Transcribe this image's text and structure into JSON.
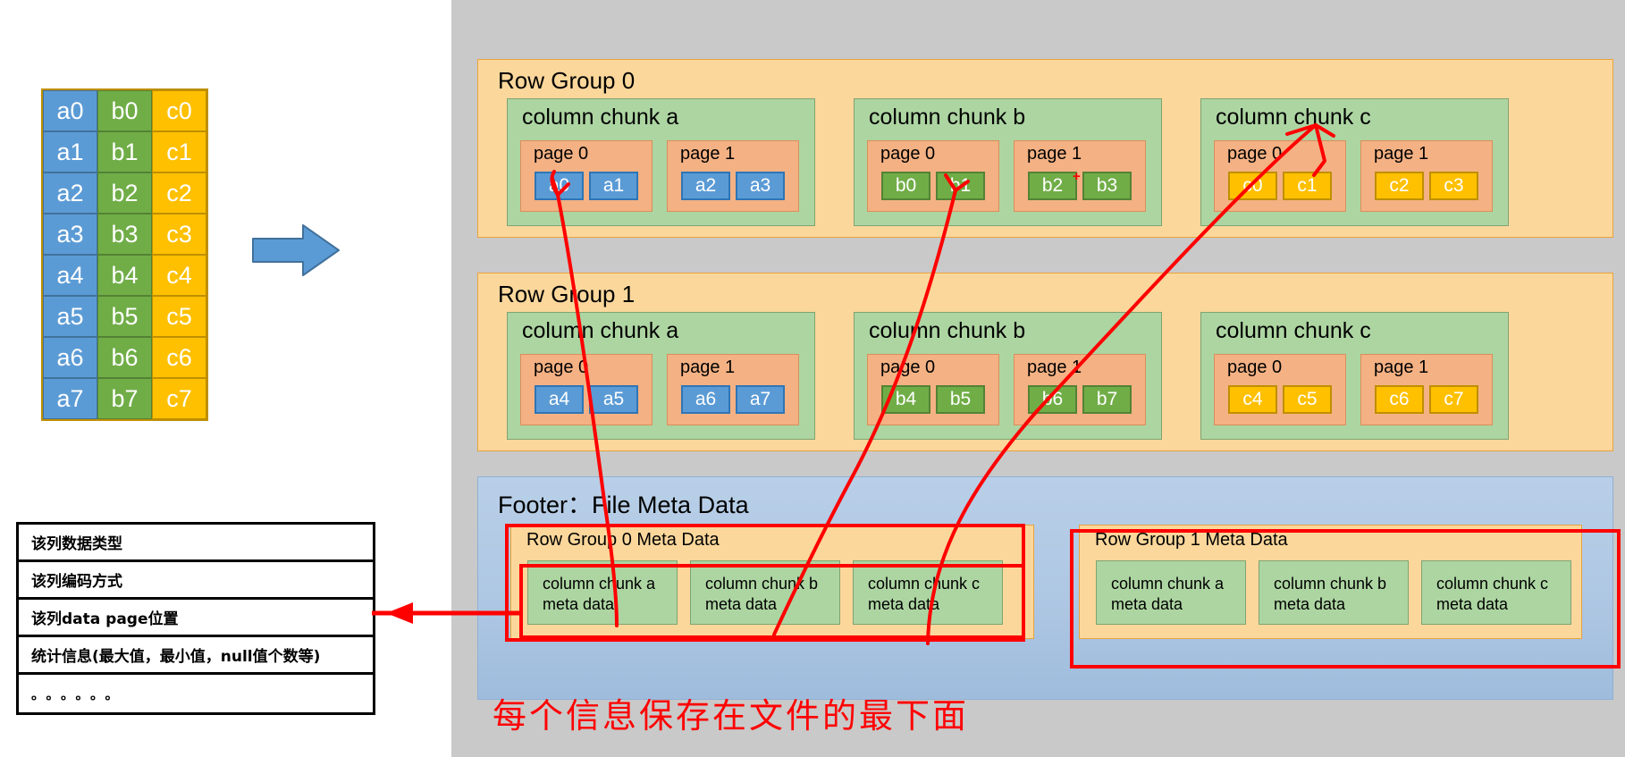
{
  "source_table": {
    "columns": [
      {
        "name": "a",
        "color": "#5b9bd5",
        "cells": [
          "a0",
          "a1",
          "a2",
          "a3",
          "a4",
          "a5",
          "a6",
          "a7"
        ]
      },
      {
        "name": "b",
        "color": "#70ad47",
        "cells": [
          "b0",
          "b1",
          "b2",
          "b3",
          "b4",
          "b5",
          "b6",
          "b7"
        ]
      },
      {
        "name": "c",
        "color": "#ffc000",
        "cells": [
          "c0",
          "c1",
          "c2",
          "c3",
          "c4",
          "c5",
          "c6",
          "c7"
        ]
      }
    ]
  },
  "flow_arrow": {
    "icon": "right-arrow-icon",
    "color": "#5b9bd5"
  },
  "column_meta_table": {
    "rows": [
      "该列数据类型",
      "该列编码方式",
      "该列data page位置",
      "统计信息(最大值，最小值，null值个数等)",
      "。。。。。。"
    ]
  },
  "row_groups": [
    {
      "title": "Row Group 0",
      "chunks": [
        {
          "title": "column chunk a",
          "pages": [
            {
              "title": "page 0",
              "values": [
                "a0",
                "a1"
              ],
              "kind": "a"
            },
            {
              "title": "page 1",
              "values": [
                "a2",
                "a3"
              ],
              "kind": "a"
            }
          ]
        },
        {
          "title": "column chunk b",
          "pages": [
            {
              "title": "page 0",
              "values": [
                "b0",
                "b1"
              ],
              "kind": "b"
            },
            {
              "title": "page 1",
              "values": [
                "b2",
                "b3"
              ],
              "kind": "b"
            }
          ]
        },
        {
          "title": "column chunk c",
          "pages": [
            {
              "title": "page 0",
              "values": [
                "c0",
                "c1"
              ],
              "kind": "c"
            },
            {
              "title": "page 1",
              "values": [
                "c2",
                "c3"
              ],
              "kind": "c"
            }
          ]
        }
      ]
    },
    {
      "title": "Row Group 1",
      "chunks": [
        {
          "title": "column chunk a",
          "pages": [
            {
              "title": "page 0",
              "values": [
                "a4",
                "a5"
              ],
              "kind": "a"
            },
            {
              "title": "page 1",
              "values": [
                "a6",
                "a7"
              ],
              "kind": "a"
            }
          ]
        },
        {
          "title": "column chunk b",
          "pages": [
            {
              "title": "page 0",
              "values": [
                "b4",
                "b5"
              ],
              "kind": "b"
            },
            {
              "title": "page 1",
              "values": [
                "b6",
                "b7"
              ],
              "kind": "b"
            }
          ]
        },
        {
          "title": "column chunk c",
          "pages": [
            {
              "title": "page 0",
              "values": [
                "c4",
                "c5"
              ],
              "kind": "c"
            },
            {
              "title": "page 1",
              "values": [
                "c6",
                "c7"
              ],
              "kind": "c"
            }
          ]
        }
      ]
    }
  ],
  "footer": {
    "title": "Footer：File Meta Data",
    "row_group_meta": [
      {
        "title": "Row Group 0 Meta Data",
        "chunks": [
          "column chunk a\nmeta data",
          "column chunk b\nmeta data",
          "column chunk c\nmeta data"
        ]
      },
      {
        "title": "Row Group 1 Meta Data",
        "chunks": [
          "column chunk a\nmeta data",
          "column chunk b\nmeta data",
          "column chunk c\nmeta data"
        ]
      }
    ]
  },
  "annotations": {
    "note_text": "每个信息保存在文件的最下面",
    "note_color": "#ff0000",
    "plus_mark": "+",
    "highlight_color": "#ff0000"
  }
}
